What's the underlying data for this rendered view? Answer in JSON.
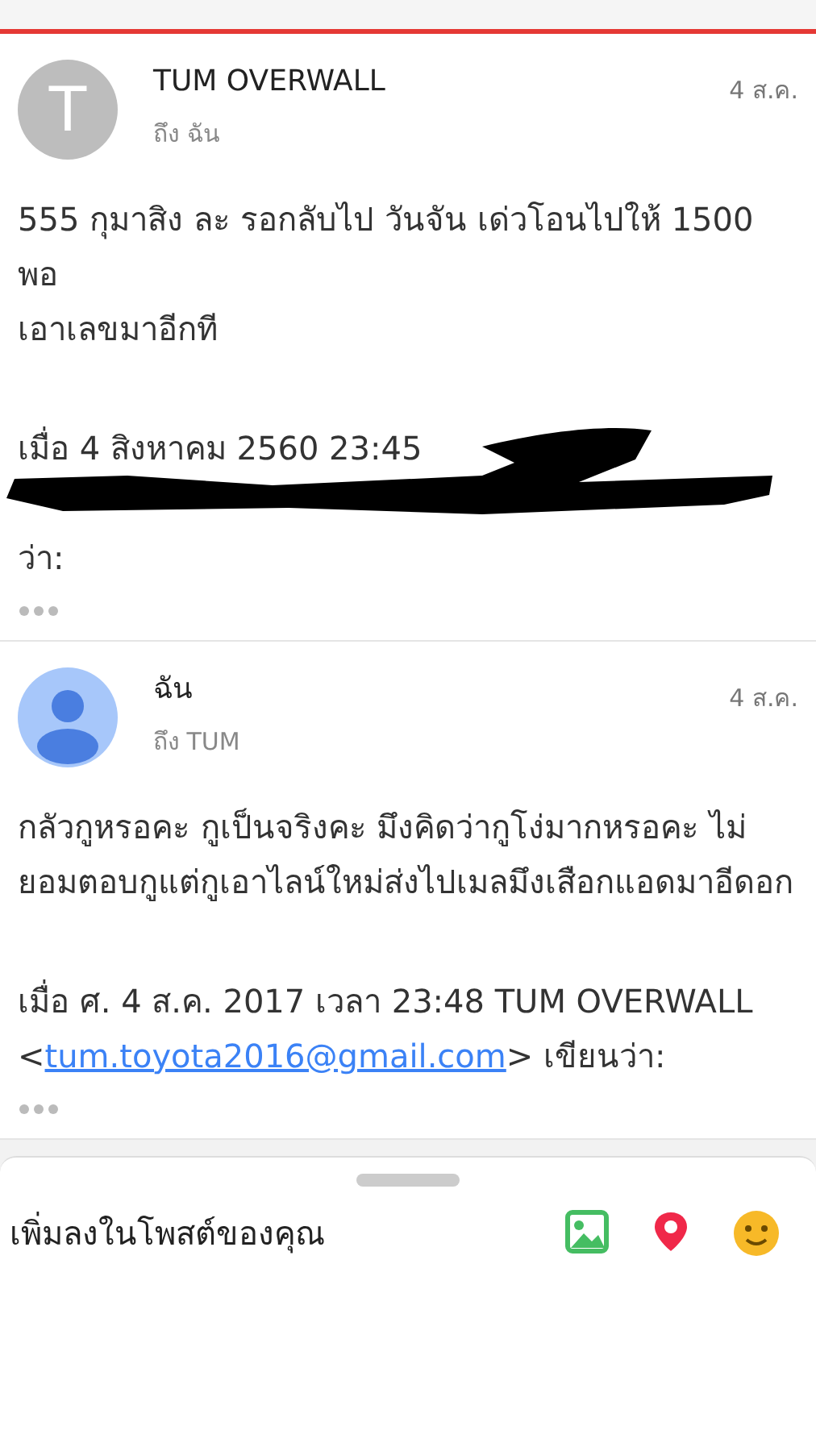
{
  "messages": [
    {
      "avatar": {
        "kind": "letter",
        "letter": "T"
      },
      "sender": "TUM OVERWALL",
      "recipient": "ถึง ฉัน",
      "date": "4 ส.ค.",
      "body": [
        "555 กุมาสิง ละ รอกลับไป วันจัน เด่วโอนไปให้ 1500 พอ",
        "เอาเลขมาอีกที"
      ],
      "quote": {
        "lines": [
          {
            "kind": "text",
            "text": "เมื่อ 4 สิงหาคม 2560 23:45"
          },
          {
            "kind": "redacted"
          },
          {
            "kind": "text",
            "text": "ว่า:"
          }
        ]
      }
    },
    {
      "avatar": {
        "kind": "person"
      },
      "sender": "ฉัน",
      "recipient": "ถึง TUM",
      "date": "4 ส.ค.",
      "body": [
        "กลัวกูหรอคะ กูเป็นจริงคะ มึงคิดว่ากูโง่มากหรอคะ ไม่ยอมตอบกูแต่กูเอาไลน์ใหม่ส่งไปเมลมึงเสือกแอดมาอีดอก"
      ],
      "quote": {
        "lines": [
          {
            "kind": "text",
            "text": "เมื่อ ศ. 4 ส.ค. 2017 เวลา 23:48 TUM OVERWALL <"
          },
          {
            "kind": "link",
            "text": "tum.toyota2016@gmail.com"
          },
          {
            "kind": "text",
            "text": "> เขียนว่า:"
          }
        ]
      }
    }
  ],
  "sheet": {
    "prompt": "เพิ่มลงในโพสต์ของคุณ"
  }
}
